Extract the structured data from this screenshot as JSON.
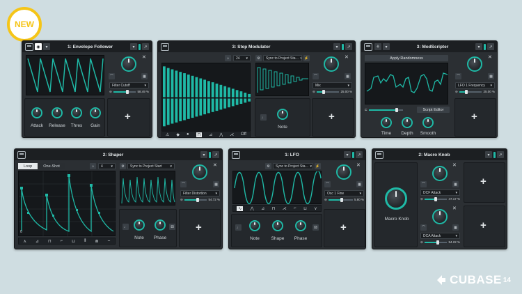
{
  "badge": {
    "text": "NEW"
  },
  "brand": {
    "name": "CUBASE",
    "version": "14"
  },
  "colors": {
    "accent": "#1fb9a6",
    "badge": "#f5c518",
    "panel": "#2b2f33",
    "background": "#cfdde1"
  },
  "panels": {
    "envelope": {
      "title": "1: Envelope Follower",
      "target": "Filter Cutoff",
      "amount": "58.49 %",
      "knobs": [
        "Attack",
        "Release",
        "Thres",
        "Gain"
      ]
    },
    "step": {
      "title": "3: Step Modulator",
      "steps": "24",
      "sync": "Sync to Project Sta…",
      "target": "Mix",
      "amount": "25.00 %",
      "off_label": "Off",
      "knob": "Note",
      "step_values": [
        0.95,
        0.9,
        0.86,
        0.82,
        0.78,
        0.74,
        0.7,
        0.66,
        0.62,
        0.58,
        0.54,
        0.5,
        0.46,
        0.42,
        0.38,
        0.34,
        0.3,
        0.26,
        0.22,
        0.18,
        0.14,
        0.1
      ]
    },
    "modscripter": {
      "title": "3: ModScripter",
      "apply_button": "Apply Randomness",
      "editor_button": "Script Editor",
      "target": "LFO 1 Frequency",
      "amount": "25.00 %",
      "knobs": [
        "Time",
        "Depth",
        "Smooth"
      ]
    },
    "shaper": {
      "title": "2: Shaper",
      "mode_loop": "Loop",
      "mode_oneshot": "One-Shot",
      "steps": "4",
      "sync": "Sync to Project Start",
      "target": "Filter Distortion",
      "amount": "54.72 %",
      "axis_zero": "0",
      "knobs": [
        "Note",
        "Phase"
      ]
    },
    "lfo": {
      "title": "1: LFO",
      "sync": "Sync to Project Sta…",
      "target": "Osc 1 Fine",
      "amount": "5.80 %",
      "knobs": [
        "Note",
        "Shape",
        "Phase"
      ]
    },
    "macro": {
      "title": "2: Macro Knob",
      "knob": "Macro Knob",
      "target1": "DCF Attack",
      "amount1": "47.17 %",
      "target2": "DCA Attack",
      "amount2": "54.22 %"
    }
  }
}
